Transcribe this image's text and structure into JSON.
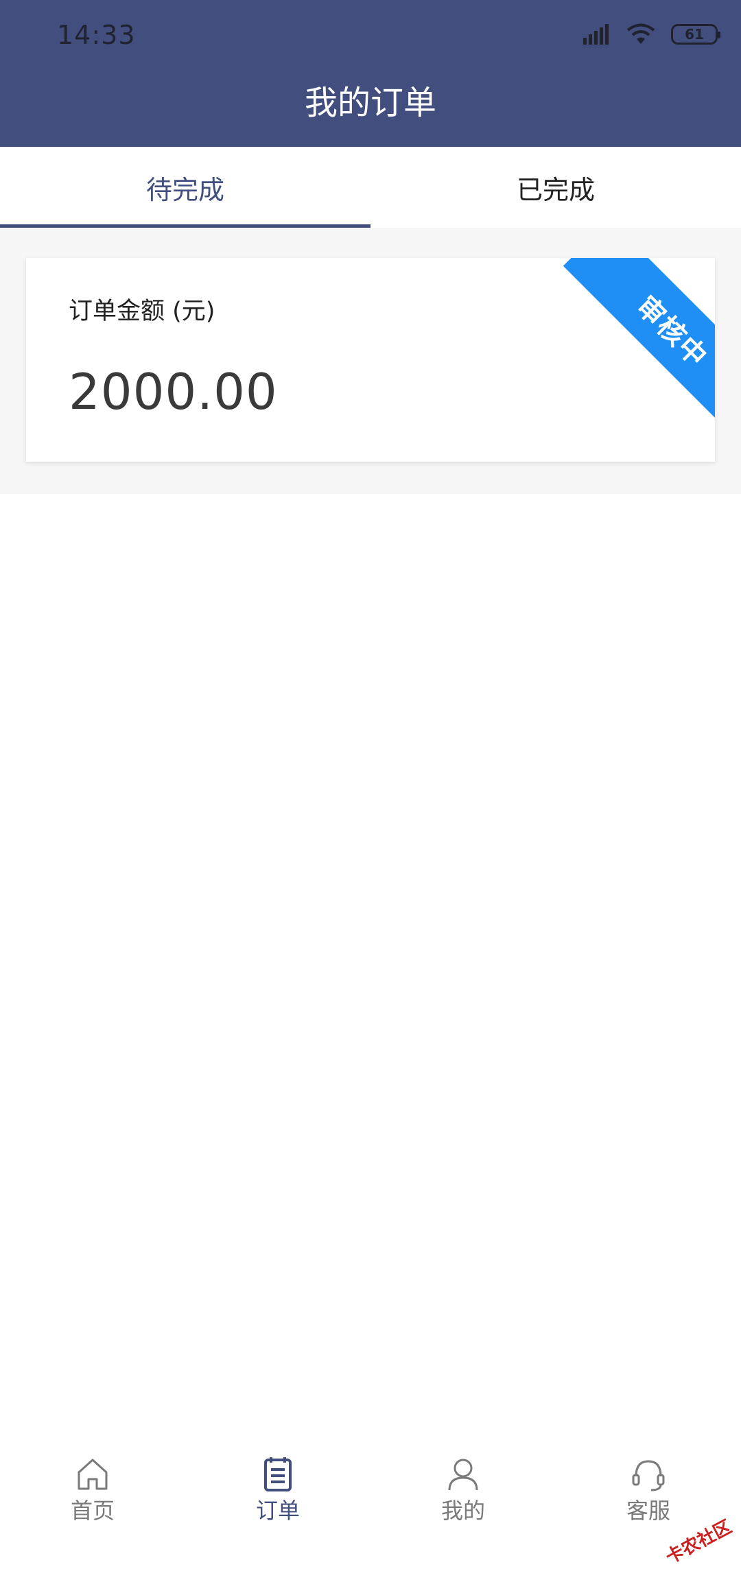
{
  "status_bar": {
    "time": "14:33",
    "battery": "61"
  },
  "header": {
    "title": "我的订单"
  },
  "tabs": [
    {
      "label": "待完成",
      "active": true
    },
    {
      "label": "已完成",
      "active": false
    }
  ],
  "order_card": {
    "amount_label": "订单金额 (元)",
    "amount": "2000.00",
    "status_ribbon": "审核中",
    "ribbon_color": "#1f8ff5"
  },
  "bottom_nav": [
    {
      "label": "首页",
      "icon": "home-icon",
      "active": false
    },
    {
      "label": "订单",
      "icon": "order-list-icon",
      "active": true
    },
    {
      "label": "我的",
      "icon": "user-icon",
      "active": false
    },
    {
      "label": "客服",
      "icon": "headset-icon",
      "active": false
    }
  ],
  "watermark": "卡农社区",
  "colors": {
    "primary": "#424f7e",
    "background": "#f6f6f6"
  }
}
